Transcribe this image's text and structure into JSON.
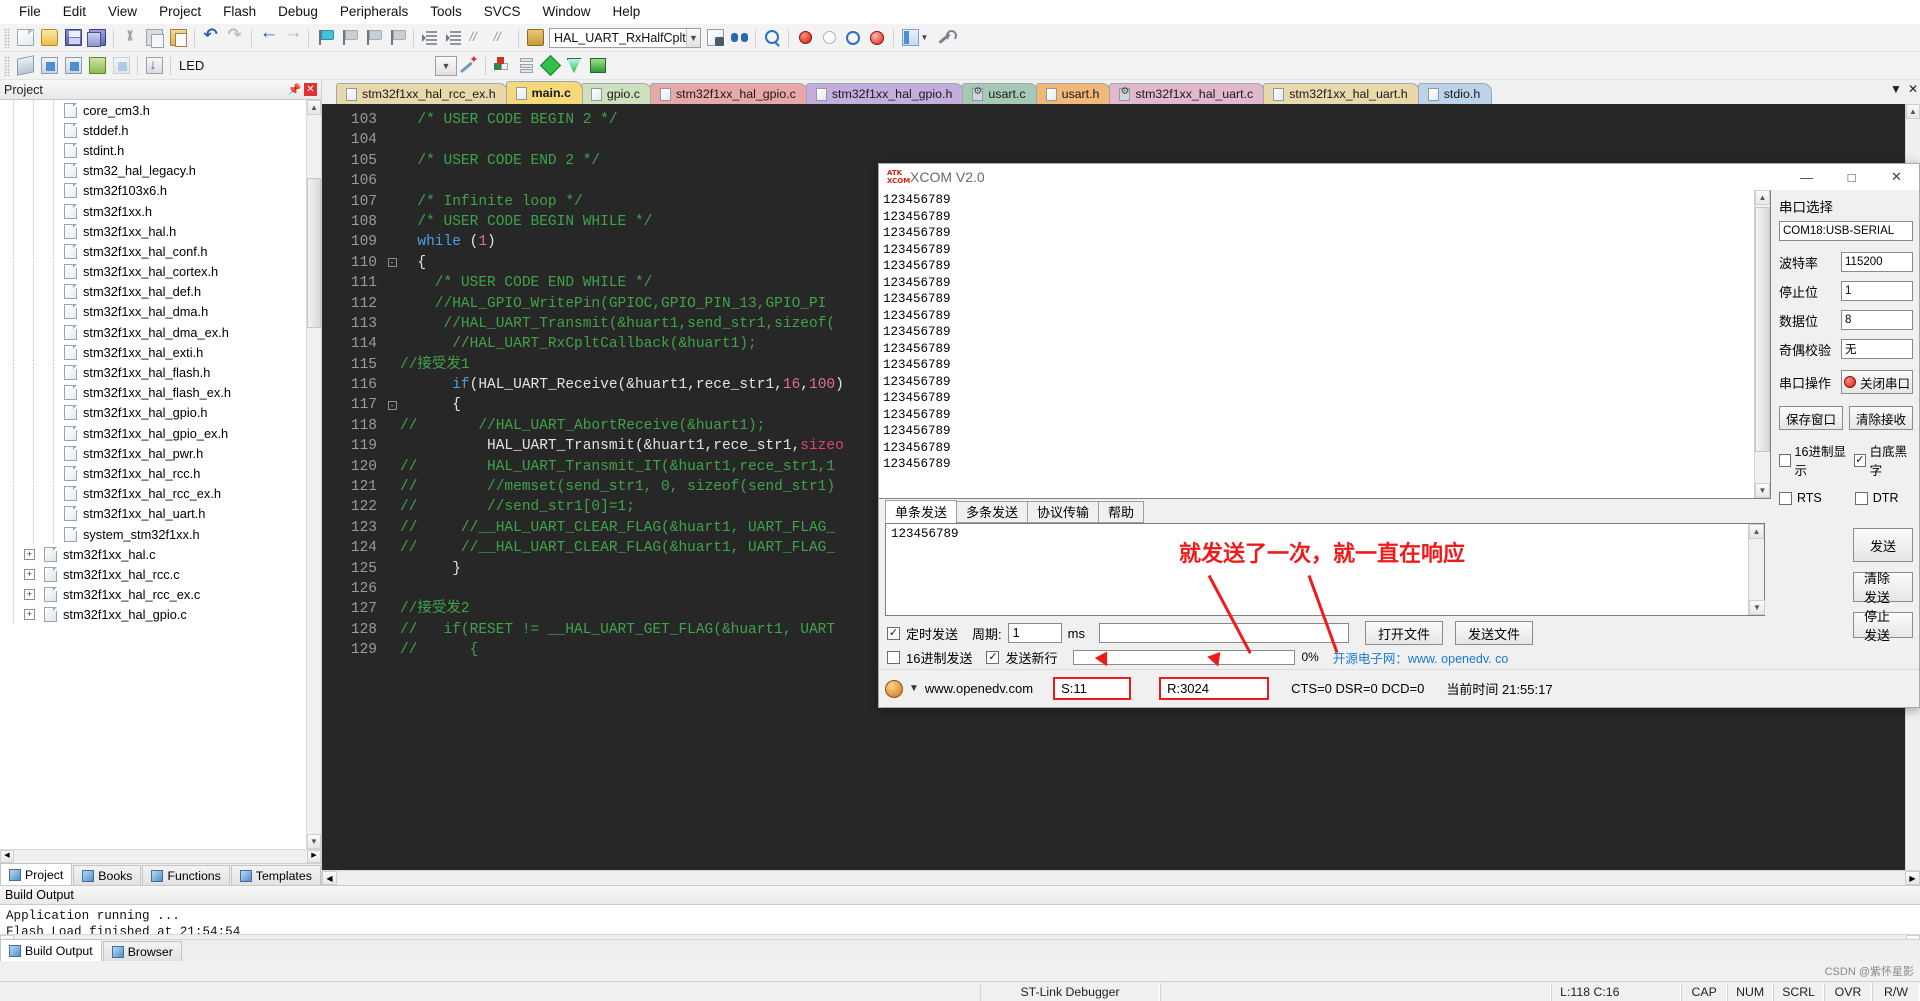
{
  "menu": [
    "File",
    "Edit",
    "View",
    "Project",
    "Flash",
    "Debug",
    "Peripherals",
    "Tools",
    "SVCS",
    "Window",
    "Help"
  ],
  "toolbar": {
    "function_combo": "HAL_UART_RxHalfCpltCal",
    "target_combo": "LED"
  },
  "project_panel": {
    "title": "Project",
    "tree": [
      {
        "label": "core_cm3.h",
        "indent": 3,
        "type": "file"
      },
      {
        "label": "stddef.h",
        "indent": 3,
        "type": "file"
      },
      {
        "label": "stdint.h",
        "indent": 3,
        "type": "file"
      },
      {
        "label": "stm32_hal_legacy.h",
        "indent": 3,
        "type": "file"
      },
      {
        "label": "stm32f103x6.h",
        "indent": 3,
        "type": "file"
      },
      {
        "label": "stm32f1xx.h",
        "indent": 3,
        "type": "file"
      },
      {
        "label": "stm32f1xx_hal.h",
        "indent": 3,
        "type": "file"
      },
      {
        "label": "stm32f1xx_hal_conf.h",
        "indent": 3,
        "type": "file"
      },
      {
        "label": "stm32f1xx_hal_cortex.h",
        "indent": 3,
        "type": "file"
      },
      {
        "label": "stm32f1xx_hal_def.h",
        "indent": 3,
        "type": "file"
      },
      {
        "label": "stm32f1xx_hal_dma.h",
        "indent": 3,
        "type": "file"
      },
      {
        "label": "stm32f1xx_hal_dma_ex.h",
        "indent": 3,
        "type": "file"
      },
      {
        "label": "stm32f1xx_hal_exti.h",
        "indent": 3,
        "type": "file"
      },
      {
        "label": "stm32f1xx_hal_flash.h",
        "indent": 3,
        "type": "file"
      },
      {
        "label": "stm32f1xx_hal_flash_ex.h",
        "indent": 3,
        "type": "file"
      },
      {
        "label": "stm32f1xx_hal_gpio.h",
        "indent": 3,
        "type": "file"
      },
      {
        "label": "stm32f1xx_hal_gpio_ex.h",
        "indent": 3,
        "type": "file"
      },
      {
        "label": "stm32f1xx_hal_pwr.h",
        "indent": 3,
        "type": "file"
      },
      {
        "label": "stm32f1xx_hal_rcc.h",
        "indent": 3,
        "type": "file"
      },
      {
        "label": "stm32f1xx_hal_rcc_ex.h",
        "indent": 3,
        "type": "file"
      },
      {
        "label": "stm32f1xx_hal_uart.h",
        "indent": 3,
        "type": "file"
      },
      {
        "label": "system_stm32f1xx.h",
        "indent": 3,
        "type": "file"
      },
      {
        "label": "stm32f1xx_hal.c",
        "indent": 2,
        "type": "src",
        "expandable": true
      },
      {
        "label": "stm32f1xx_hal_rcc.c",
        "indent": 2,
        "type": "src",
        "expandable": true
      },
      {
        "label": "stm32f1xx_hal_rcc_ex.c",
        "indent": 2,
        "type": "src",
        "expandable": true
      },
      {
        "label": "stm32f1xx_hal_gpio.c",
        "indent": 2,
        "type": "src",
        "expandable": true
      }
    ],
    "tabs": [
      {
        "label": "Project",
        "icon": "project-icon",
        "active": true
      },
      {
        "label": "Books",
        "icon": "books-icon",
        "active": false
      },
      {
        "label": "Functions",
        "icon": "functions-icon",
        "active": false
      },
      {
        "label": "Templates",
        "icon": "templates-icon",
        "active": false
      }
    ]
  },
  "editor": {
    "tabs": [
      {
        "label": "stm32f1xx_hal_rcc_ex.h",
        "color": "#e8d9ab",
        "active": false,
        "icon": "file"
      },
      {
        "label": "main.c",
        "color": "#f5d97a",
        "active": true,
        "icon": "file"
      },
      {
        "label": "gpio.c",
        "color": "#cfe0bd",
        "active": false,
        "icon": "file"
      },
      {
        "label": "stm32f1xx_hal_gpio.c",
        "color": "#e8a8a8",
        "active": false,
        "icon": "file"
      },
      {
        "label": "stm32f1xx_hal_gpio.h",
        "color": "#c4aede",
        "active": false,
        "icon": "file"
      },
      {
        "label": "usart.c",
        "color": "#a6c9b5",
        "active": false,
        "icon": "gear"
      },
      {
        "label": "usart.h",
        "color": "#f2b87a",
        "active": false,
        "icon": "file"
      },
      {
        "label": "stm32f1xx_hal_uart.c",
        "color": "#e2b8cc",
        "active": false,
        "icon": "gear"
      },
      {
        "label": "stm32f1xx_hal_uart.h",
        "color": "#e8d9ab",
        "active": false,
        "icon": "file"
      },
      {
        "label": "stdio.h",
        "color": "#bcd4ea",
        "active": false,
        "icon": "file"
      }
    ],
    "first_line": 103,
    "lines": [
      {
        "n": 103,
        "text": "  /* USER CODE BEGIN 2 */",
        "cls": "cm"
      },
      {
        "n": 104,
        "text": "",
        "cls": ""
      },
      {
        "n": 105,
        "text": "  /* USER CODE END 2 */",
        "cls": "cm"
      },
      {
        "n": 106,
        "text": "",
        "cls": ""
      },
      {
        "n": 107,
        "text": "  /* Infinite loop */",
        "cls": "cm"
      },
      {
        "n": 108,
        "text": "  /* USER CODE BEGIN WHILE */",
        "cls": "cm"
      },
      {
        "n": 109,
        "text": "  while (1)",
        "cls": "code-while"
      },
      {
        "n": 110,
        "text": "  {",
        "cls": "",
        "fold": true
      },
      {
        "n": 111,
        "text": "    /* USER CODE END WHILE */",
        "cls": "cm"
      },
      {
        "n": 112,
        "text": "    //HAL_GPIO_WritePin(GPIOC,GPIO_PIN_13,GPIO_PI",
        "cls": "cm"
      },
      {
        "n": 113,
        "text": "     //HAL_UART_Transmit(&huart1,send_str1,sizeof(",
        "cls": "cm"
      },
      {
        "n": 114,
        "text": "      //HAL_UART_RxCpltCallback(&huart1);",
        "cls": "cm"
      },
      {
        "n": 115,
        "text": "//接受发1",
        "cls": "cm"
      },
      {
        "n": 116,
        "text": "      if(HAL_UART_Receive(&huart1,rece_str1,16,100)",
        "cls": "code-if"
      },
      {
        "n": 117,
        "text": "      {",
        "cls": "",
        "fold": true
      },
      {
        "n": 118,
        "text": "//       //HAL_UART_AbortReceive(&huart1);",
        "cls": "cm"
      },
      {
        "n": 119,
        "text": "          HAL_UART_Transmit(&huart1,rece_str1,sizeo",
        "cls": "code-tx"
      },
      {
        "n": 120,
        "text": "//        HAL_UART_Transmit_IT(&huart1,rece_str1,1",
        "cls": "cm"
      },
      {
        "n": 121,
        "text": "//        //memset(send_str1, 0, sizeof(send_str1)",
        "cls": "cm"
      },
      {
        "n": 122,
        "text": "//        //send_str1[0]=1;",
        "cls": "cm"
      },
      {
        "n": 123,
        "text": "//     //__HAL_UART_CLEAR_FLAG(&huart1, UART_FLAG_",
        "cls": "cm"
      },
      {
        "n": 124,
        "text": "//     //__HAL_UART_CLEAR_FLAG(&huart1, UART_FLAG_",
        "cls": "cm"
      },
      {
        "n": 125,
        "text": "      }",
        "cls": ""
      },
      {
        "n": 126,
        "text": "",
        "cls": ""
      },
      {
        "n": 127,
        "text": "//接受发2",
        "cls": "cm"
      },
      {
        "n": 128,
        "text": "//   if(RESET != __HAL_UART_GET_FLAG(&huart1, UART",
        "cls": "cm"
      },
      {
        "n": 129,
        "text": "//      {",
        "cls": "cm"
      }
    ]
  },
  "build_output": {
    "title": "Build Output",
    "lines": [
      "Application running ...",
      "Flash Load finished at 21:54:54"
    ],
    "tabs": [
      {
        "label": "Build Output",
        "active": true
      },
      {
        "label": "Browser",
        "active": false
      }
    ]
  },
  "status_bar": {
    "debugger": "ST-Link Debugger",
    "position": "L:118 C:16",
    "caps": "CAP",
    "num": "NUM",
    "scrl": "SCRL",
    "ovr": "OVR",
    "rw": "R/W",
    "watermark": "CSDN @紫怀星影"
  },
  "xcom": {
    "title": "XCOM V2.0",
    "logo_top": "ATK",
    "logo_bottom": "XCOM",
    "window_buttons": [
      "—",
      "□",
      "✕"
    ],
    "receive_lines": [
      "123456789",
      "123456789",
      "123456789",
      "123456789",
      "123456789",
      "123456789",
      "123456789",
      "123456789",
      "123456789",
      "123456789",
      "123456789",
      "123456789",
      "123456789",
      "123456789",
      "123456789",
      "123456789",
      "123456789"
    ],
    "send_tabs": [
      {
        "label": "单条发送",
        "active": true
      },
      {
        "label": "多条发送",
        "active": false
      },
      {
        "label": "协议传输",
        "active": false
      },
      {
        "label": "帮助",
        "active": false
      }
    ],
    "send_text": "123456789",
    "annotation": "就发送了一次，就一直在响应",
    "options": {
      "timed_send_label": "定时发送",
      "timed_send_checked": true,
      "period_label": "周期:",
      "period_value": "1",
      "period_unit": "ms",
      "hex_send_label": "16进制发送",
      "hex_send_checked": false,
      "newline_send_label": "发送新行",
      "newline_send_checked": true,
      "progress_label": "0%"
    },
    "buttons": {
      "send": "发送",
      "clear_send": "清除发送",
      "open_file": "打开文件",
      "send_file": "发送文件",
      "stop_send": "停止发送"
    },
    "right_panel": {
      "port_select_label": "串口选择",
      "port_value": "COM18:USB-SERIAL",
      "baud_label": "波特率",
      "baud_value": "115200",
      "stopbits_label": "停止位",
      "stopbits_value": "1",
      "databits_label": "数据位",
      "databits_value": "8",
      "parity_label": "奇偶校验",
      "parity_value": "无",
      "serial_op_label": "串口操作",
      "serial_op_value": "关闭串口",
      "save_window": "保存窗口",
      "clear_receive": "清除接收",
      "hex_display_label": "16进制显示",
      "hex_display_checked": false,
      "white_bg_label": "白底黑字",
      "white_bg_checked": true,
      "rts_label": "RTS",
      "rts_checked": false,
      "dtr_label": "DTR",
      "dtr_checked": false
    },
    "footer": {
      "site": "www.openedv.com",
      "sent": "S:11",
      "received": "R:3024",
      "flags": "CTS=0 DSR=0 DCD=0",
      "time_label": "当前时间 21:55:17",
      "promo": "开源电子网：www. openedv. co"
    }
  }
}
